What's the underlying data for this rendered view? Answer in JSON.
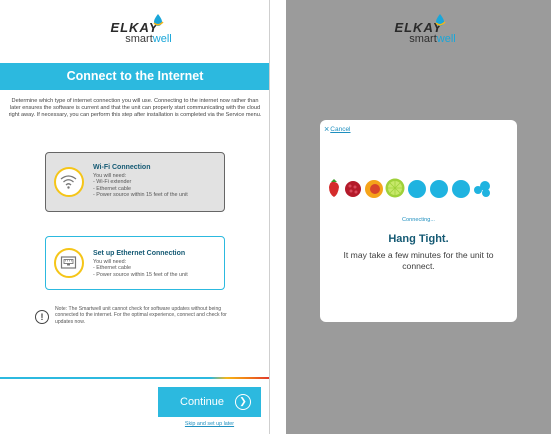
{
  "left_screen": {
    "brand": "ELKAY",
    "brand_sub_a": "smart",
    "brand_sub_b": "well",
    "banner_title": "Connect to the Internet",
    "intro": "Determine which type of internet connection you will use. Connecting to the internet now rather than later ensures the software is current and that the unit can properly start communicating with the cloud right away. If necessary, you can perform this step after installation is completed via the Service menu.",
    "wifi": {
      "title": "Wi-Fi Connection",
      "need_label": "You will need:",
      "items": [
        "- Wi-Fi extender",
        "- Ethernet cable",
        "- Power source within 15 feet of the unit"
      ]
    },
    "ethernet": {
      "title": "Set up Ethernet Connection",
      "need_label": "You will need:",
      "items": [
        "- Ethernet cable",
        "- Power source within 15 feet of the unit"
      ]
    },
    "note_icon": "!",
    "note": "Note: The Smartwell unit cannot check for software updates without being connected to the internet. For the optimal experience, connect and check for updates now.",
    "continue_label": "Continue",
    "skip_label": "Skip and set up later"
  },
  "right_screen": {
    "brand": "ELKAY",
    "brand_sub_a": "smart",
    "brand_sub_b": "well",
    "cancel_label": "Cancel",
    "cancel_icon": "×",
    "connecting": "Connecting...",
    "heading": "Hang Tight.",
    "message": "It may take a few minutes for the unit to connect."
  },
  "colors": {
    "accent": "#2cb9df",
    "icon_ring": "#f5c518",
    "heading": "#155a74",
    "overlay": "#9b9b9b"
  }
}
